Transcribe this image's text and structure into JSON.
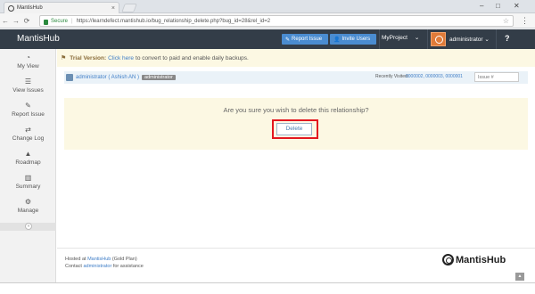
{
  "browser": {
    "tab_title": "MantisHub",
    "tab_close": "×",
    "win_min": "–",
    "win_max": "□",
    "win_close": "✕",
    "back": "←",
    "forward": "→",
    "reload": "⟳",
    "secure_label": "Secure",
    "url_separator": "|",
    "url": "https://learndefect.mantishub.io/bug_relationship_delete.php?bug_id=28&rel_id=2",
    "menu": "⋮"
  },
  "navbar": {
    "brand": "MantisHub",
    "report_issue": "Report Issue",
    "invite_users": "Invite Users",
    "project": "MyProject",
    "user": "administrator",
    "help": "?"
  },
  "sidebar": {
    "items": [
      {
        "label": "My View",
        "icon": "dashboard-icon"
      },
      {
        "label": "View Issues",
        "icon": "list-icon"
      },
      {
        "label": "Report Issue",
        "icon": "edit-icon"
      },
      {
        "label": "Change Log",
        "icon": "retweet-icon"
      },
      {
        "label": "Roadmap",
        "icon": "road-icon"
      },
      {
        "label": "Summary",
        "icon": "bar-chart-icon"
      },
      {
        "label": "Manage",
        "icon": "gears-icon"
      }
    ],
    "collapse": "«"
  },
  "trial": {
    "label": "Trial Version:",
    "link": "Click here",
    "text": "to convert to paid and enable daily backups."
  },
  "userbar": {
    "user": "administrator ( Ashish AN )",
    "role": "administrator",
    "recent_label": "Recently Visited:",
    "recent_issues": "0000002, 0000003, 0000001",
    "issue_placeholder": "Issue #"
  },
  "confirm": {
    "question": "Are you sure you wish to delete this relationship?",
    "delete_label": "Delete"
  },
  "footer": {
    "hosted_prefix": "Hosted at",
    "hosted_link": "MantisHub",
    "plan": "(Gold Plan)",
    "contact_prefix": "Contact",
    "contact_link": "administrator",
    "contact_suffix": "for assistance",
    "logo_text": "MantisHub",
    "scroll_top": "▲"
  }
}
